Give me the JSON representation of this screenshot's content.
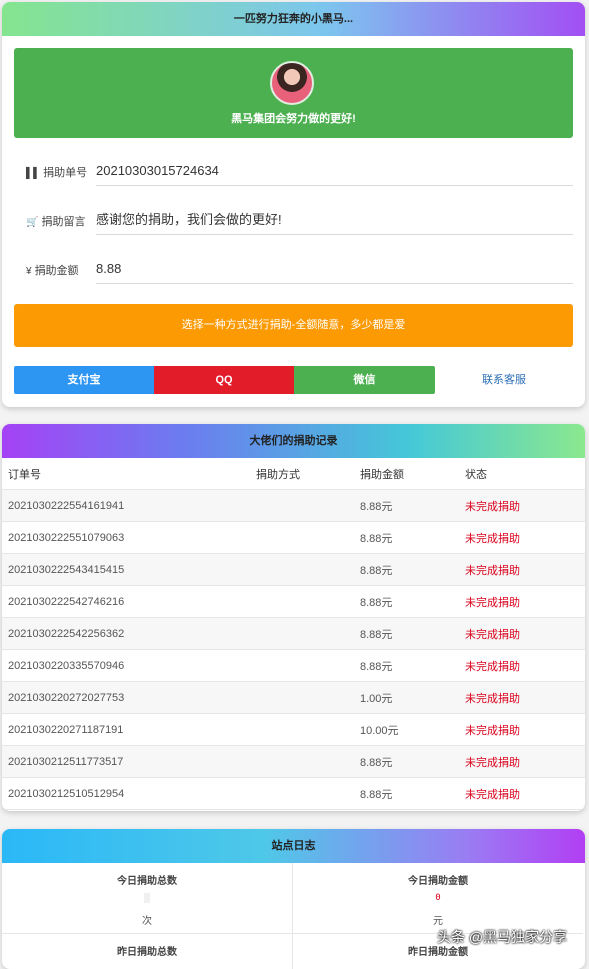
{
  "donate_card": {
    "header": "一匹努力狂奔的小黑马...",
    "banner_text": "黑马集团会努力做的更好!",
    "fields": [
      {
        "icon": "barcode-icon",
        "label": "捐助单号",
        "value": "20210303015724634"
      },
      {
        "icon": "cart-icon",
        "label": "捐助留言",
        "value": "感谢您的捐助，我们会做的更好!"
      },
      {
        "icon": "yen-icon",
        "label": "捐助金额",
        "value": "8.88"
      }
    ],
    "notice": "选择一种方式进行捐助-全额随意，多少都是爱",
    "pay_buttons": [
      "支付宝",
      "QQ",
      "微信"
    ],
    "contact_link": "联系客服",
    "colors": {
      "alipay": "#2d96f3",
      "qq": "#e31c2a",
      "wechat": "#4cb050",
      "notice": "#fb9a02"
    }
  },
  "records_card": {
    "header": "大佬们的捐助记录",
    "columns": [
      "订单号",
      "捐助方式",
      "捐助金额",
      "状态"
    ],
    "rows": [
      {
        "order": "2021030222554161941",
        "method": "",
        "amount": "8.88元",
        "status": "未完成捐助"
      },
      {
        "order": "2021030222551079063",
        "method": "",
        "amount": "8.88元",
        "status": "未完成捐助"
      },
      {
        "order": "2021030222543415415",
        "method": "",
        "amount": "8.88元",
        "status": "未完成捐助"
      },
      {
        "order": "2021030222542746216",
        "method": "",
        "amount": "8.88元",
        "status": "未完成捐助"
      },
      {
        "order": "2021030222542256362",
        "method": "",
        "amount": "8.88元",
        "status": "未完成捐助"
      },
      {
        "order": "2021030220335570946",
        "method": "",
        "amount": "8.88元",
        "status": "未完成捐助"
      },
      {
        "order": "2021030220272027753",
        "method": "",
        "amount": "1.00元",
        "status": "未完成捐助"
      },
      {
        "order": "2021030220271187191",
        "method": "",
        "amount": "10.00元",
        "status": "未完成捐助"
      },
      {
        "order": "2021030212511773517",
        "method": "",
        "amount": "8.88元",
        "status": "未完成捐助"
      },
      {
        "order": "2021030212510512954",
        "method": "",
        "amount": "8.88元",
        "status": "未完成捐助"
      }
    ]
  },
  "log_card": {
    "header": "站点日志",
    "stats": [
      {
        "title": "今日捐助总数",
        "value": "",
        "unit": "次"
      },
      {
        "title": "今日捐助金额",
        "value": "0",
        "unit": "元"
      },
      {
        "title": "昨日捐助总数",
        "value": "",
        "unit": ""
      },
      {
        "title": "昨日捐助金额",
        "value": "",
        "unit": ""
      }
    ]
  },
  "watermark": "头条 @黑马独家分享"
}
